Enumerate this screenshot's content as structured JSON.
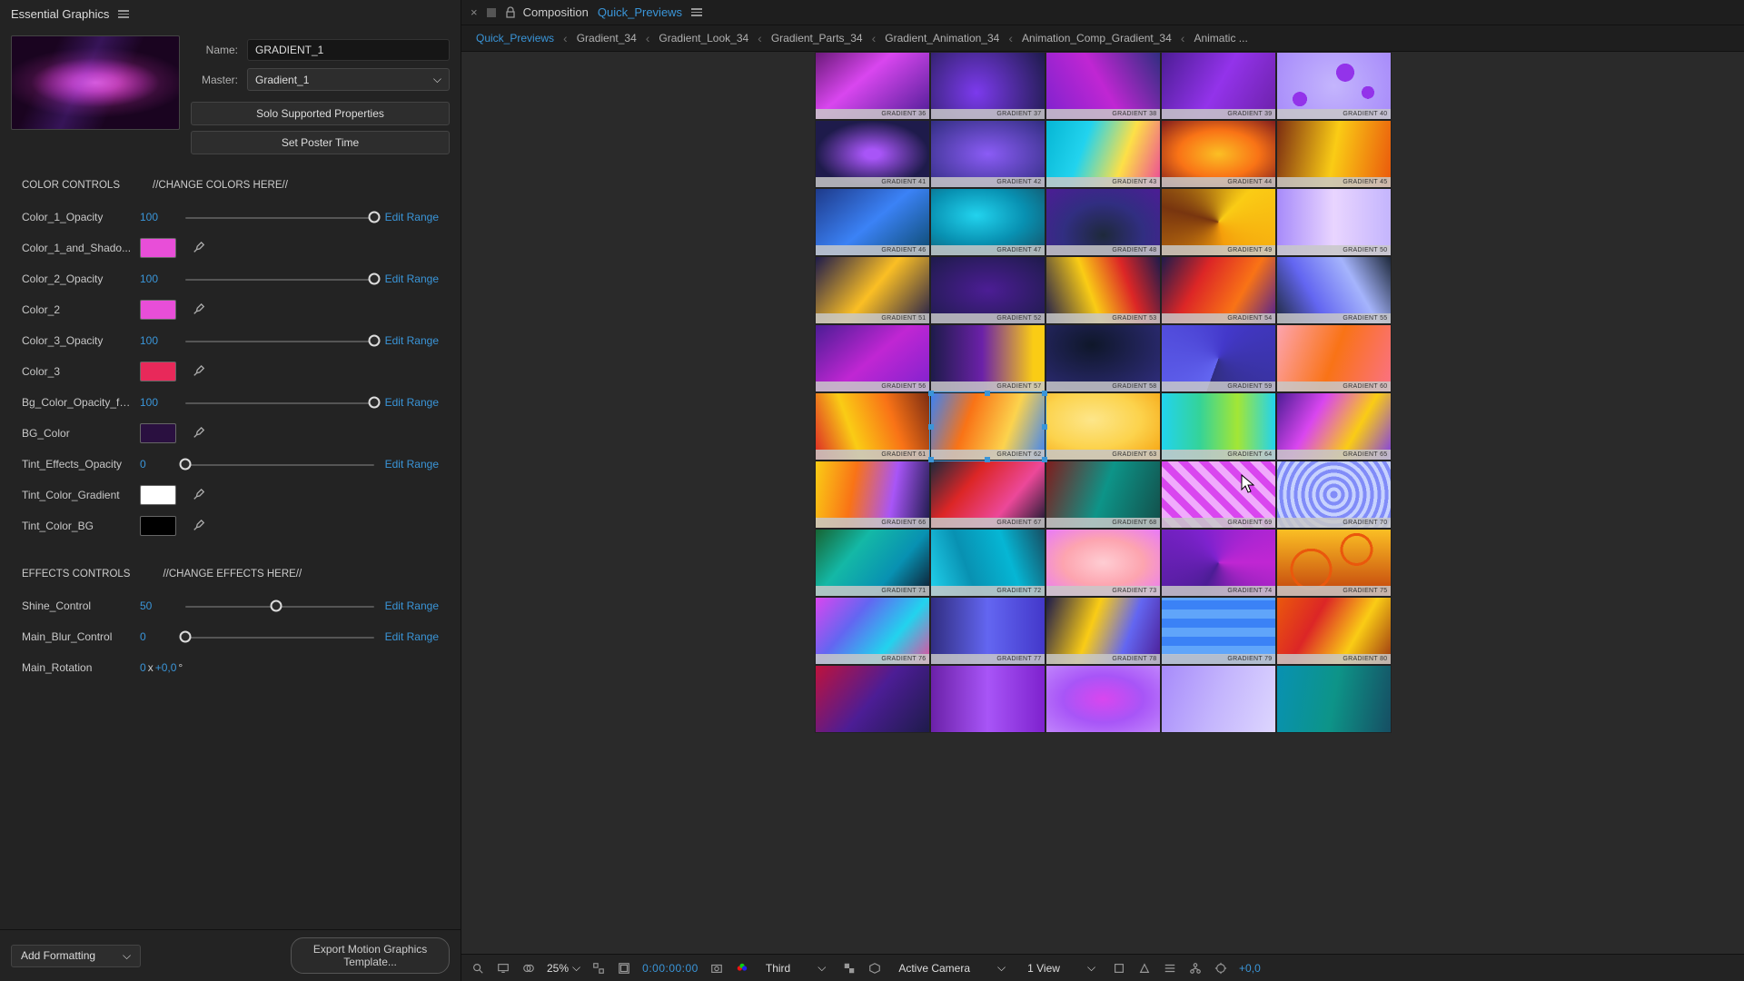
{
  "panel": {
    "title": "Essential Graphics",
    "name_label": "Name:",
    "name_value": "GRADIENT_1",
    "master_label": "Master:",
    "master_value": "Gradient_1",
    "solo_btn": "Solo Supported Properties",
    "poster_btn": "Set Poster Time"
  },
  "color_section": {
    "title": "COLOR CONTROLS",
    "hint": "//CHANGE COLORS HERE//",
    "rows": [
      {
        "label": "Color_1_Opacity",
        "value": "100",
        "type": "slider",
        "pos": 100,
        "edit": "Edit Range"
      },
      {
        "label": "Color_1_and_Shado...",
        "type": "color",
        "swatch": "#e84ed8"
      },
      {
        "label": "Color_2_Opacity",
        "value": "100",
        "type": "slider",
        "pos": 100,
        "edit": "Edit Range"
      },
      {
        "label": "Color_2",
        "type": "color",
        "swatch": "#e84ed8"
      },
      {
        "label": "Color_3_Opacity",
        "value": "100",
        "type": "slider",
        "pos": 100,
        "edit": "Edit Range"
      },
      {
        "label": "Color_3",
        "type": "color",
        "swatch": "#e8295a"
      },
      {
        "label": "Bg_Color_Opacity_fo...",
        "value": "100",
        "type": "slider",
        "pos": 100,
        "edit": "Edit Range"
      },
      {
        "label": "BG_Color",
        "type": "color",
        "swatch": "#2a1040"
      },
      {
        "label": "Tint_Effects_Opacity",
        "value": "0",
        "type": "slider",
        "pos": 0,
        "edit": "Edit Range"
      },
      {
        "label": "Tint_Color_Gradient",
        "type": "color",
        "swatch": "#ffffff"
      },
      {
        "label": "Tint_Color_BG",
        "type": "color",
        "swatch": "#000000"
      }
    ]
  },
  "effects_section": {
    "title": "EFFECTS CONTROLS",
    "hint": "//CHANGE EFFECTS HERE//",
    "rows": [
      {
        "label": "Shine_Control",
        "value": "50",
        "type": "slider",
        "pos": 48,
        "edit": "Edit Range"
      },
      {
        "label": "Main_Blur_Control",
        "value": "0",
        "type": "slider",
        "pos": 0,
        "edit": "Edit Range"
      },
      {
        "label": "Main_Rotation",
        "type": "rotation",
        "turns": "0",
        "deg": "+0,0",
        "suffix": "°"
      }
    ]
  },
  "bottom": {
    "add_formatting": "Add Formatting",
    "export": "Export Motion Graphics Template..."
  },
  "comp": {
    "prefix": "Composition",
    "name": "Quick_Previews",
    "breadcrumbs": [
      {
        "label": "Quick_Previews",
        "active": true
      },
      {
        "label": "Gradient_34"
      },
      {
        "label": "Gradient_Look_34"
      },
      {
        "label": "Gradient_Parts_34"
      },
      {
        "label": "Gradient_Animation_34"
      },
      {
        "label": "Animation_Comp_Gradient_34"
      },
      {
        "label": "Animatic ..."
      }
    ]
  },
  "viewer_footer": {
    "zoom": "25%",
    "time": "0:00:00:00",
    "quality": "Third",
    "camera": "Active Camera",
    "views": "1 View",
    "plus": "+0,0"
  },
  "grid": {
    "cols": 5,
    "rows": 10,
    "cells": [
      {
        "g": "linear-gradient(140deg,#6b1a7a,#d946ef 40%,#4c1d95)",
        "l": "GRADIENT 36"
      },
      {
        "g": "radial-gradient(circle at 40% 60%,#7c3aed,#1e1b4b)",
        "l": "GRADIENT 37"
      },
      {
        "g": "linear-gradient(60deg,#7e22ce,#c026d3,#312e81)",
        "l": "GRADIENT 38"
      },
      {
        "g": "linear-gradient(120deg,#4c1d95,#9333ea,#6b21a8)",
        "l": "GRADIENT 39"
      },
      {
        "g": "radial-gradient(circle at 70% 30%,#c084fc,#a855f7);",
        "l": "GRADIENT 40",
        "extra": "background-image:radial-gradient(circle at 20% 70%,#9333ea 8px,transparent 8px),radial-gradient(circle at 60% 30%,#9333ea 10px,transparent 10px),radial-gradient(circle at 80% 60%,#9333ea 7px,transparent 7px),radial-gradient(circle,#c4b5fd,#a78bfa)"
      },
      {
        "g": "radial-gradient(ellipse at 50% 50%,#a855f7 10%,#1e1b4b 70%)",
        "l": "GRADIENT 41"
      },
      {
        "g": "radial-gradient(ellipse at 50% 50%,#8b5cf6,#312e81)",
        "l": "GRADIENT 42"
      },
      {
        "g": "linear-gradient(110deg,#06b6d4,#22d3ee,#fde047,#ec4899)",
        "l": "GRADIENT 43"
      },
      {
        "g": "radial-gradient(ellipse at 50% 50%,#fbbf24,#f97316,#7f1d1d)",
        "l": "GRADIENT 44"
      },
      {
        "g": "linear-gradient(100deg,#7c2d12,#facc15,#ea580c)",
        "l": "GRADIENT 45"
      },
      {
        "g": "linear-gradient(140deg,#1e3a8a,#3b82f6,#0c4a6e)",
        "l": "GRADIENT 46"
      },
      {
        "g": "radial-gradient(ellipse at 40% 40%,#22d3ee,#0891b2,#164e63)",
        "l": "GRADIENT 47"
      },
      {
        "g": "radial-gradient(ellipse at 50% 70%,#1e293b,#312e81,#4c1d95)",
        "l": "GRADIENT 48"
      },
      {
        "g": "conic-gradient(from 45deg,#facc15,#f59e0b,#78350f,#facc15)",
        "l": "GRADIENT 49"
      },
      {
        "g": "linear-gradient(90deg,#a78bfa,#e9d5ff,#c4b5fd)",
        "l": "GRADIENT 50"
      },
      {
        "g": "linear-gradient(130deg,#1e1b4b,#fbbf24 50%,#1e1b4b)",
        "l": "GRADIENT 51"
      },
      {
        "g": "radial-gradient(ellipse,#4c1d95,#1e1b4b)",
        "l": "GRADIENT 52"
      },
      {
        "g": "linear-gradient(70deg,#1e1b4b,#facc15 40%,#dc2626,#1e1b4b)",
        "l": "GRADIENT 53"
      },
      {
        "g": "linear-gradient(120deg,#1e1b4b,#dc2626,#f97316,#4c1d95)",
        "l": "GRADIENT 54"
      },
      {
        "g": "linear-gradient(60deg,#1e293b,#6366f1,#a5b4fc,#1e293b)",
        "l": "GRADIENT 55"
      },
      {
        "g": "linear-gradient(140deg,#4c1d95,#c026d3,#7e22ce)",
        "l": "GRADIENT 56"
      },
      {
        "g": "linear-gradient(90deg,#1e1b4b,#6b21a8,#facc15 90%)",
        "l": "GRADIENT 57"
      },
      {
        "g": "radial-gradient(ellipse at 40% 30%,#0f172a,#312e81)",
        "l": "GRADIENT 58"
      },
      {
        "g": "conic-gradient(from 200deg,#6366f1,#4338ca,#312e81)",
        "l": "GRADIENT 59"
      },
      {
        "g": "linear-gradient(110deg,#fda4af,#f97316,#fb7185)",
        "l": "GRADIENT 60"
      },
      {
        "g": "linear-gradient(70deg,#dc2626,#facc15,#f97316,#7c2d12)",
        "l": "GRADIENT 61"
      },
      {
        "g": "linear-gradient(110deg,#3b82f6,#f97316,#fcd34d,#3b82f6)",
        "l": "GRADIENT 62",
        "sel": true
      },
      {
        "g": "radial-gradient(ellipse at 40% 40%,#fde68a,#fcd34d,#f59e0b)",
        "l": "GRADIENT 63"
      },
      {
        "g": "linear-gradient(90deg,#22d3ee,#34d399,#a3e635,#22d3ee)",
        "l": "GRADIENT 64"
      },
      {
        "g": "linear-gradient(120deg,#4c1d95,#d946ef,#facc15,#7c3aed)",
        "l": "GRADIENT 65"
      },
      {
        "g": "linear-gradient(100deg,#facc15,#f97316,#a855f7,#1e1b4b)",
        "l": "GRADIENT 66"
      },
      {
        "g": "linear-gradient(130deg,#1e293b,#dc2626,#ec4899,#0f172a)",
        "l": "GRADIENT 67"
      },
      {
        "g": "linear-gradient(110deg,#7f1d1d,#0d9488,#134e4a)",
        "l": "GRADIENT 68"
      },
      {
        "g": "repeating-linear-gradient(45deg,#d946ef 0 8px,#f0abfc 8px 16px)",
        "l": "GRADIENT 69"
      },
      {
        "g": "radial-gradient(circle at 50% 50%,#a5b4fc,#818cf8,#c7d2fe)",
        "l": "GRADIENT 70",
        "extra": "background-image:repeating-radial-gradient(circle,#818cf8 0 4px,#c7d2fe 4px 8px)"
      },
      {
        "g": "linear-gradient(130deg,#166534,#14b8a6,#0891b2,#0f172a)",
        "l": "GRADIENT 71"
      },
      {
        "g": "linear-gradient(70deg,#22d3ee,#0891b2,#06b6d4,#164e63)",
        "l": "GRADIENT 72"
      },
      {
        "g": "radial-gradient(ellipse at 50% 50%,#fecdd3,#fda4af,#e879f9)",
        "l": "GRADIENT 73"
      },
      {
        "g": "conic-gradient(from 90deg,#c026d3,#4c1d95,#7e22ce,#c026d3)",
        "l": "GRADIENT 74"
      },
      {
        "g": "radial-gradient(circle at 60% 40%,#fbbf24,#f97316,#c2410c)",
        "l": "GRADIENT 75",
        "extra": "background-image:radial-gradient(circle at 70% 30%,transparent 15px,#ea580c 15px 18px,transparent 18px),radial-gradient(circle at 30% 60%,transparent 20px,#ea580c 20px 23px,transparent 23px),linear-gradient(#fbbf24,#c2410c)"
      },
      {
        "g": "linear-gradient(130deg,#d946ef,#6366f1,#22d3ee,#ec4899)",
        "l": "GRADIENT 76"
      },
      {
        "g": "linear-gradient(90deg,#312e81,#6366f1,#4338ca)",
        "l": "GRADIENT 77"
      },
      {
        "g": "linear-gradient(110deg,#1e1b4b,#facc15 40%,#6366f1,#4c1d95)",
        "l": "GRADIENT 78"
      },
      {
        "g": "repeating-linear-gradient(0deg,#3b82f6 0 10px,#60a5fa 10px 20px)",
        "l": "GRADIENT 79"
      },
      {
        "g": "linear-gradient(120deg,#ea580c,#dc2626,#facc15,#9a3412)",
        "l": "GRADIENT 80"
      },
      {
        "g": "linear-gradient(130deg,#be123c,#4c1d95,#1e1b4b)",
        "l": ""
      },
      {
        "g": "linear-gradient(90deg,#6b21a8,#a855f7,#7e22ce)",
        "l": ""
      },
      {
        "g": "radial-gradient(ellipse,#d946ef,#a855f7,#c084fc)",
        "l": ""
      },
      {
        "g": "linear-gradient(110deg,#a78bfa,#c4b5fd,#ddd6fe)",
        "l": ""
      },
      {
        "g": "linear-gradient(100deg,#0891b2,#0d9488,#164e63)",
        "l": ""
      }
    ]
  }
}
